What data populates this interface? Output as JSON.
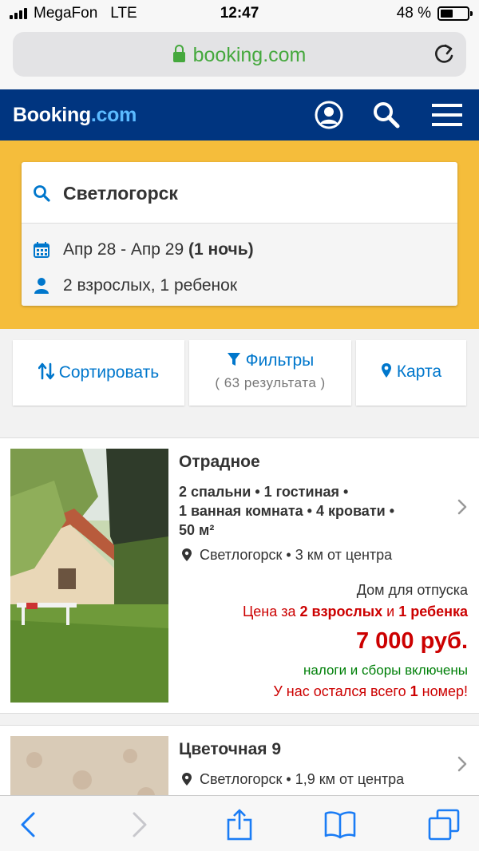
{
  "status_bar": {
    "carrier": "MegaFon",
    "network": "LTE",
    "time": "12:47",
    "battery": "48 %",
    "battery_level": 0.48
  },
  "browser": {
    "url": "booking.com",
    "secure": true
  },
  "header": {
    "logo_main": "Booking",
    "logo_suffix": ".com",
    "icons": [
      "account-icon",
      "search-icon",
      "menu-icon"
    ]
  },
  "search": {
    "destination": "Светлогорск",
    "dates": "Апр 28 - Апр 29",
    "nights": "(1 ночь)",
    "guests": "2 взрослых, 1 ребенок"
  },
  "actions": {
    "sort_label": "Сортировать",
    "filter_label": "Фильтры",
    "results_count": "( 63 результата )",
    "map_label": "Карта"
  },
  "results": [
    {
      "name": "Отрадное",
      "details_line1": "2 спальни • 1 гостиная •",
      "details_line2": "1 ванная комната • 4 кровати •",
      "details_line3": "50 м²",
      "location": "Светлогорск • 3 км от центра",
      "property_type": "Дом для отпуска",
      "price_for_prefix": "Цена за ",
      "price_for_adults": "2 взрослых",
      "price_for_and": " и ",
      "price_for_child": "1 ребенка",
      "price": "7 000 руб.",
      "taxes": "налоги и сборы включены",
      "rooms_left_prefix": "У нас остался всего ",
      "rooms_left_count": "1",
      "rooms_left_suffix": " номер!"
    },
    {
      "name": "Цветочная 9",
      "location": "Светлогорск • 1,9 км от центра"
    }
  ],
  "colors": {
    "brand_blue": "#003580",
    "brand_yellow": "#f5bd3b",
    "link_blue": "#0077cc",
    "price_red": "#cc0000",
    "ok_green": "#008009"
  },
  "toolbar": {
    "icons": [
      "back-icon",
      "forward-icon",
      "share-icon",
      "bookmarks-icon",
      "tabs-icon"
    ]
  }
}
